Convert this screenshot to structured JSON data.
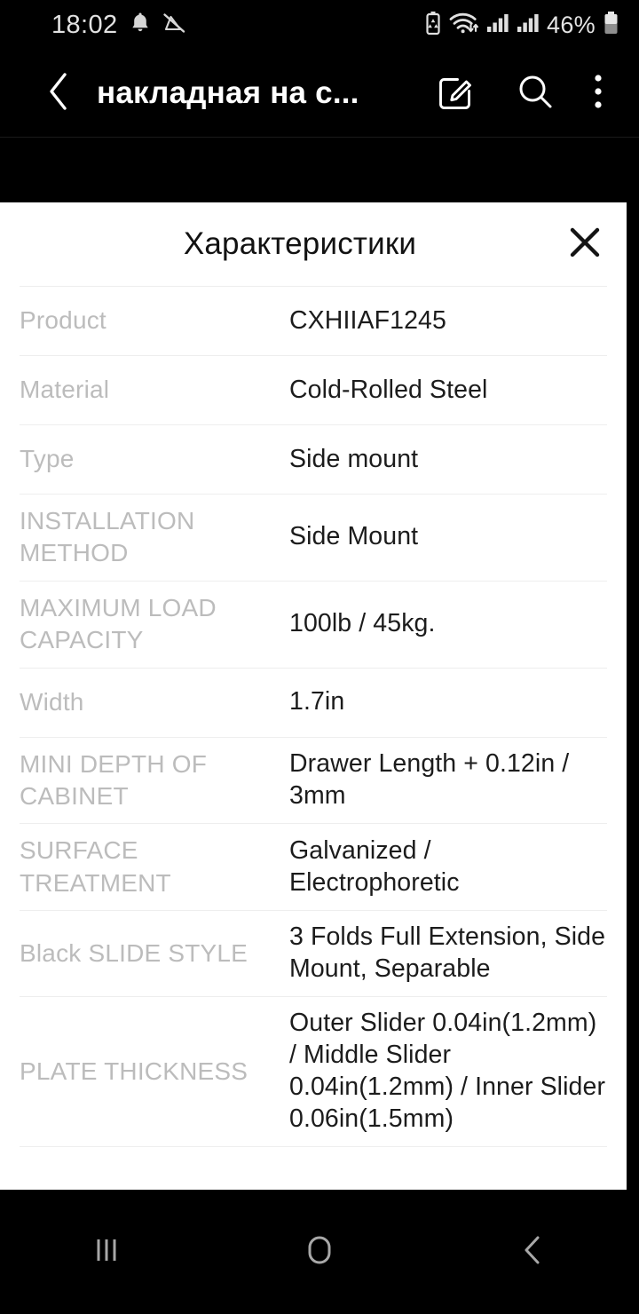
{
  "status_bar": {
    "time": "18:02",
    "battery_percent": "46%",
    "icons": [
      "bell-icon",
      "sound-off-icon",
      "battery-saver-icon",
      "wifi-icon",
      "signal-icon-1",
      "signal-icon-2",
      "battery-icon"
    ]
  },
  "toolbar": {
    "title": "накладная на с...",
    "back_icon": "back-chevron-icon",
    "edit_icon": "edit-pencil-icon",
    "search_icon": "search-icon",
    "more_icon": "overflow-menu-icon"
  },
  "sheet": {
    "title": "Характеристики",
    "close_icon": "close-icon",
    "specs": [
      {
        "label": "Product",
        "value": "CXHIIAF1245"
      },
      {
        "label": "Material",
        "value": "Cold-Rolled Steel"
      },
      {
        "label": "Type",
        "value": "Side mount"
      },
      {
        "label": "INSTALLATION METHOD",
        "value": "Side Mount"
      },
      {
        "label": "MAXIMUM LOAD CAPACITY",
        "value": "100lb / 45kg."
      },
      {
        "label": "Width",
        "value": "1.7in"
      },
      {
        "label": "MINI DEPTH OF CABINET",
        "value": "Drawer Length + 0.12in / 3mm"
      },
      {
        "label": "SURFACE TREATMENT",
        "value": "Galvanized / Electrophoretic"
      },
      {
        "label": "Black SLIDE STYLE",
        "value": "3 Folds Full Extension, Side Mount, Separable"
      },
      {
        "label": "PLATE THICKNESS",
        "value": "Outer Slider 0.04in(1.2mm) / Middle Slider 0.04in(1.2mm) / Inner Slider 0.06in(1.5mm)"
      }
    ]
  },
  "nav_bar": {
    "recents_icon": "recents-icon",
    "home_icon": "home-icon",
    "back_icon": "back-icon"
  },
  "colors": {
    "background": "#000000",
    "sheet_background": "#ffffff",
    "label_text": "#bcbcbc",
    "value_text": "#1c1c1c",
    "divider": "#eeeeee"
  }
}
